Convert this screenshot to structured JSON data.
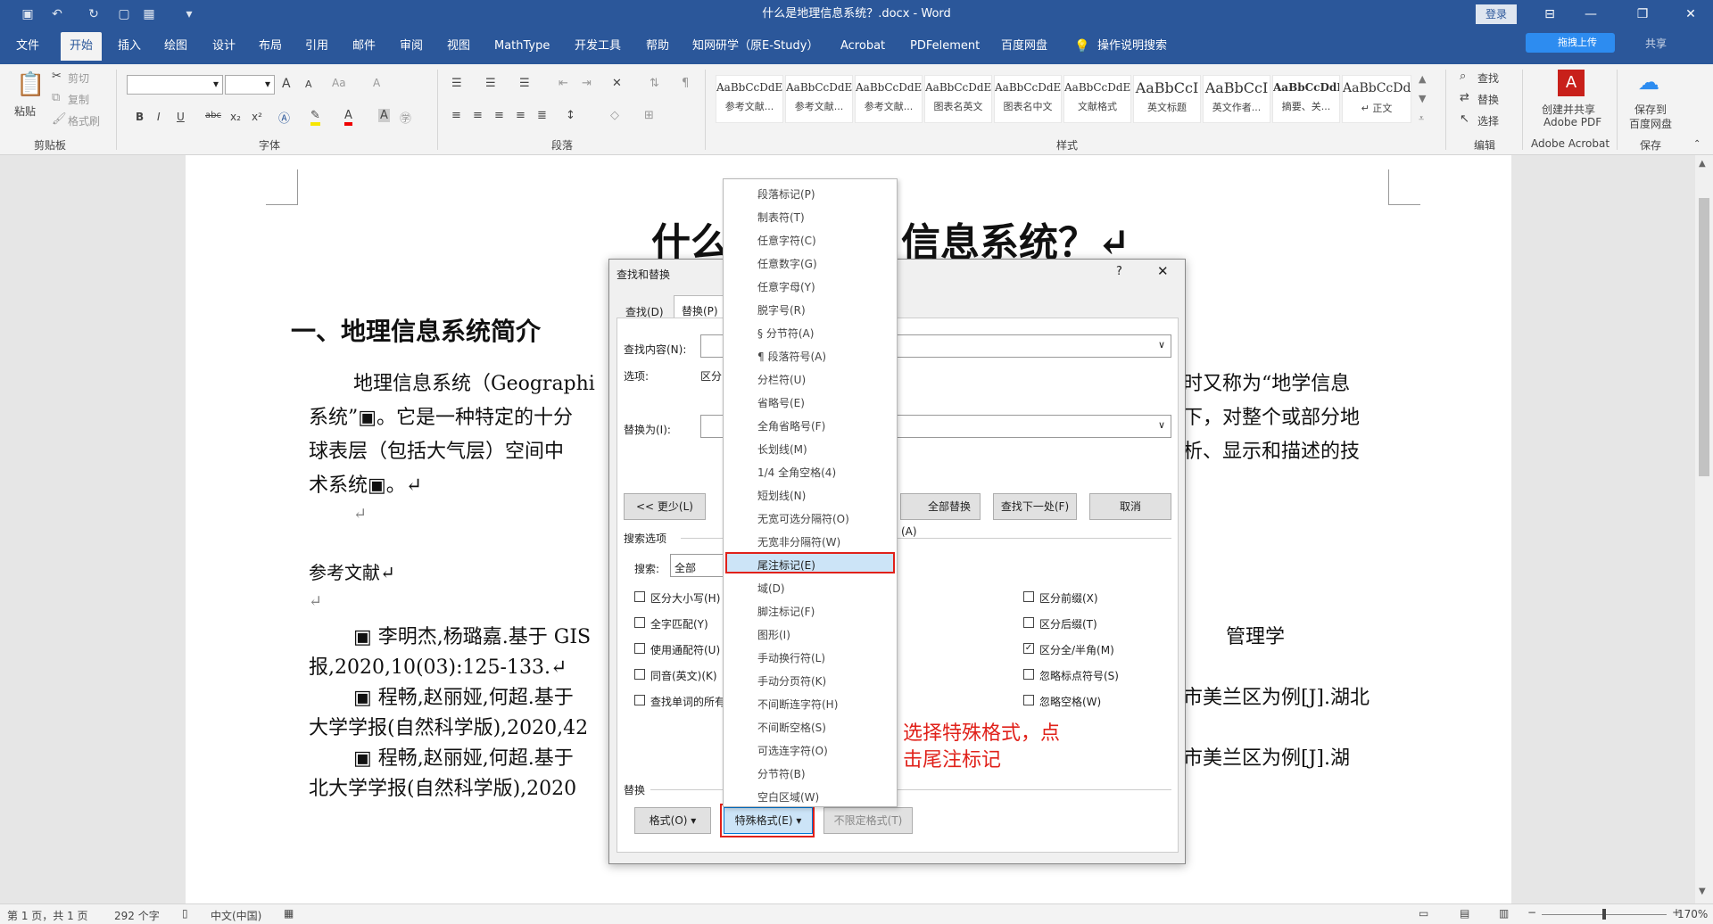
{
  "titlebar": {
    "title": "什么是地理信息系统？.docx  -  Word",
    "login": "登录"
  },
  "tabs": [
    "文件",
    "开始",
    "插入",
    "绘图",
    "设计",
    "布局",
    "引用",
    "邮件",
    "审阅",
    "视图",
    "MathType",
    "开发工具",
    "帮助",
    "知网研学（原E-Study）",
    "Acrobat",
    "PDFelement",
    "百度网盘",
    "操作说明搜索"
  ],
  "tab_extra": {
    "upload": "拖拽上传",
    "share": "共享"
  },
  "ribbon": {
    "clipboard": {
      "paste": "粘贴",
      "cut": "剪切",
      "copy": "复制",
      "format_painter": "格式刷",
      "label": "剪贴板"
    },
    "font": {
      "label": "字体",
      "grow": "A",
      "shrink": "A",
      "case": "Aa",
      "clear": "A",
      "bold": "B",
      "italic": "I",
      "underline": "U",
      "strike": "abc",
      "sub": "x₂",
      "sup": "x²"
    },
    "paragraph": {
      "label": "段落"
    },
    "styles": {
      "label": "样式",
      "items": [
        {
          "preview": "AaBbCcDdE",
          "name": "参考文献..."
        },
        {
          "preview": "AaBbCcDdEe",
          "name": "参考文献..."
        },
        {
          "preview": "AaBbCcDdEe",
          "name": "参考文献..."
        },
        {
          "preview": "AaBbCcDdEe",
          "name": "图表名英文"
        },
        {
          "preview": "AaBbCcDdEe",
          "name": "图表名中文"
        },
        {
          "preview": "AaBbCcDdEe",
          "name": "文献格式"
        },
        {
          "preview": "AaBbCcI",
          "name": "英文标题"
        },
        {
          "preview": "AaBbCcI",
          "name": "英文作者..."
        },
        {
          "preview": "AaBbCcDdE",
          "name": "摘要、关..."
        },
        {
          "preview": "AaBbCcDd",
          "name": "↵ 正文"
        }
      ]
    },
    "editing": {
      "find": "查找",
      "replace": "替换",
      "select": "选择",
      "label": "编辑"
    },
    "acrobat": {
      "line1": "创建并共享",
      "line2": "Adobe PDF",
      "label": "Adobe Acrobat"
    },
    "save": {
      "line1": "保存到",
      "line2": "百度网盘",
      "label": "保存"
    }
  },
  "document": {
    "title_visible_left": "什么",
    "title_visible_right": "信息系统？↵",
    "heading": "一、地理信息系统简介",
    "para1_line1_left": "地理信息系统（Geographi",
    "para1_line1_right": "时又称为“地学信息",
    "para1_line2_left": "系统”▣。它是一种特定的十分",
    "para1_line2_right": "下，对整个或部分地",
    "para1_line3_left": "球表层（包括大气层）空间中",
    "para1_line3_right": "析、显示和描述的技",
    "para1_line4": "术系统▣。↵",
    "blank": "↵",
    "ref_title": "参考文献↵",
    "blank2": "↵",
    "ref1_left": "▣ 李明杰,杨璐嘉.基于 GIS",
    "ref1_right": "管理学",
    "ref1_line2": "报,2020,10(03):125-133.↵",
    "ref2_left": "▣ 程畅,赵丽娅,何超.基于",
    "ref2_right": "市美兰区为例[J].湖北",
    "ref2_line2": "大学学报(自然科学版),2020,42",
    "ref3_left": "▣ 程畅,赵丽娅,何超.基于",
    "ref3_right": "市美兰区为例[J].湖",
    "ref3_line2": "北大学学报(自然科学版),2020"
  },
  "dialog": {
    "title": "查找和替换",
    "help": "?",
    "close": "✕",
    "tab_find": "查找(D)",
    "tab_replace": "替换(P)",
    "find_label": "查找内容(N):",
    "options_label": "选项:",
    "options_value": "区分",
    "replace_label": "替换为(I):",
    "less_btn": "<< 更少(L)",
    "replace_all_btn": "全部替换(A)",
    "find_next_btn": "查找下一处(F)",
    "cancel_btn": "取消",
    "search_options": "搜索选项",
    "search_label": "搜索:",
    "search_value": "全部",
    "left_checks": [
      "区分大小写(H)",
      "全字匹配(Y)",
      "使用通配符(U)",
      "同音(英文)(K)",
      "查找单词的所有"
    ],
    "right_checks": [
      {
        "label": "区分前缀(X)",
        "checked": false
      },
      {
        "label": "区分后缀(T)",
        "checked": false
      },
      {
        "label": "区分全/半角(M)",
        "checked": true
      },
      {
        "label": "忽略标点符号(S)",
        "checked": false
      },
      {
        "label": "忽略空格(W)",
        "checked": false
      }
    ],
    "replace_section": "替换",
    "format_btn": "格式(O) ▾",
    "special_btn": "特殊格式(E) ▾",
    "no_format_btn": "不限定格式(T)"
  },
  "special_menu": [
    "段落标记(P)",
    "制表符(T)",
    "任意字符(C)",
    "任意数字(G)",
    "任意字母(Y)",
    "脱字号(R)",
    "§ 分节符(A)",
    "¶ 段落符号(A)",
    "分栏符(U)",
    "省略号(E)",
    "全角省略号(F)",
    "长划线(M)",
    "1/4 全角空格(4)",
    "短划线(N)",
    "无宽可选分隔符(O)",
    "无宽非分隔符(W)",
    "尾注标记(E)",
    "域(D)",
    "脚注标记(F)",
    "图形(I)",
    "手动换行符(L)",
    "手动分页符(K)",
    "不间断连字符(H)",
    "不间断空格(S)",
    "可选连字符(O)",
    "分节符(B)",
    "空白区域(W)"
  ],
  "annotation": {
    "line1": "选择特殊格式，点",
    "line2": "击尾注标记"
  },
  "status": {
    "page": "第 1 页，共 1 页",
    "words": "292 个字",
    "lang": "中文(中国)",
    "zoom": "170%"
  }
}
